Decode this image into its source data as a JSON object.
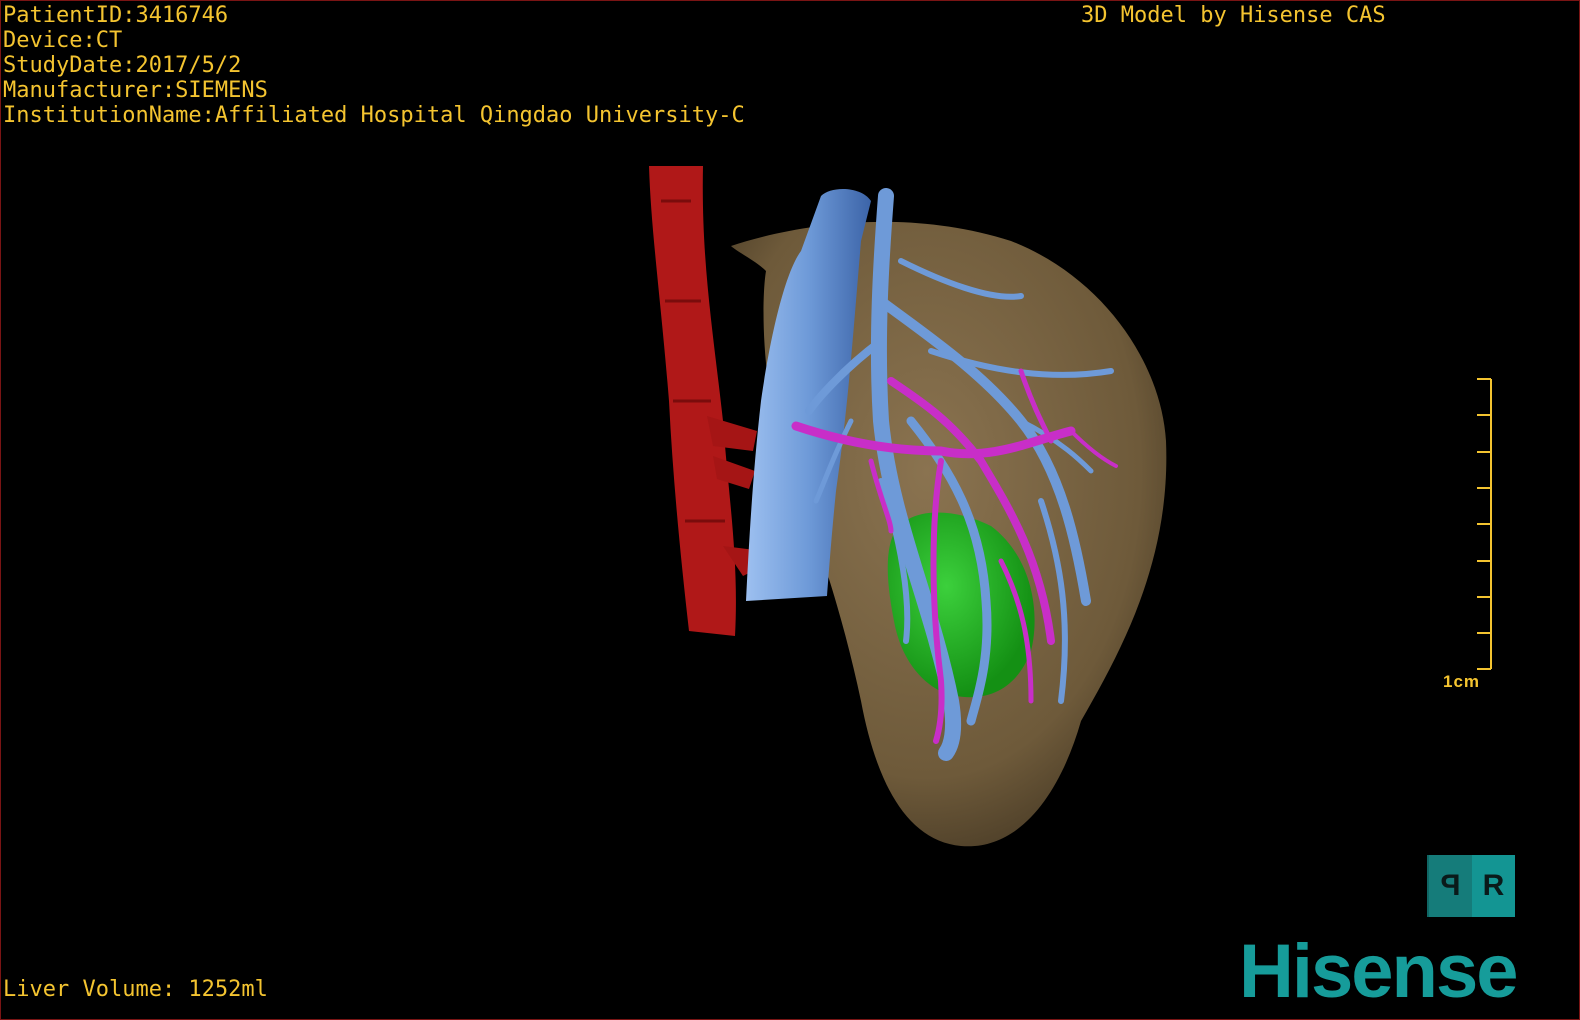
{
  "patient_info": {
    "patient_id": "PatientID:3416746",
    "device": "Device:CT",
    "study_date": "StudyDate:2017/5/2",
    "manufacturer": "Manufacturer:SIEMENS",
    "institution": "InstitutionName:Affiliated Hospital Qingdao University-C"
  },
  "model_credit": "3D Model by Hisense CAS",
  "liver_volume": "Liver Volume: 1252ml",
  "scale_bar": {
    "label": "1cm"
  },
  "orientation_cube": {
    "left_face": "P",
    "right_face": "R"
  },
  "brand": "Hisense",
  "colors": {
    "overlay_text": "#f4c430",
    "liver": "#7a6440",
    "artery": "#b01818",
    "vein": "#6e9ad8",
    "portal": "#c82ec8",
    "tumor": "#22b022",
    "brand": "#169c9a"
  }
}
